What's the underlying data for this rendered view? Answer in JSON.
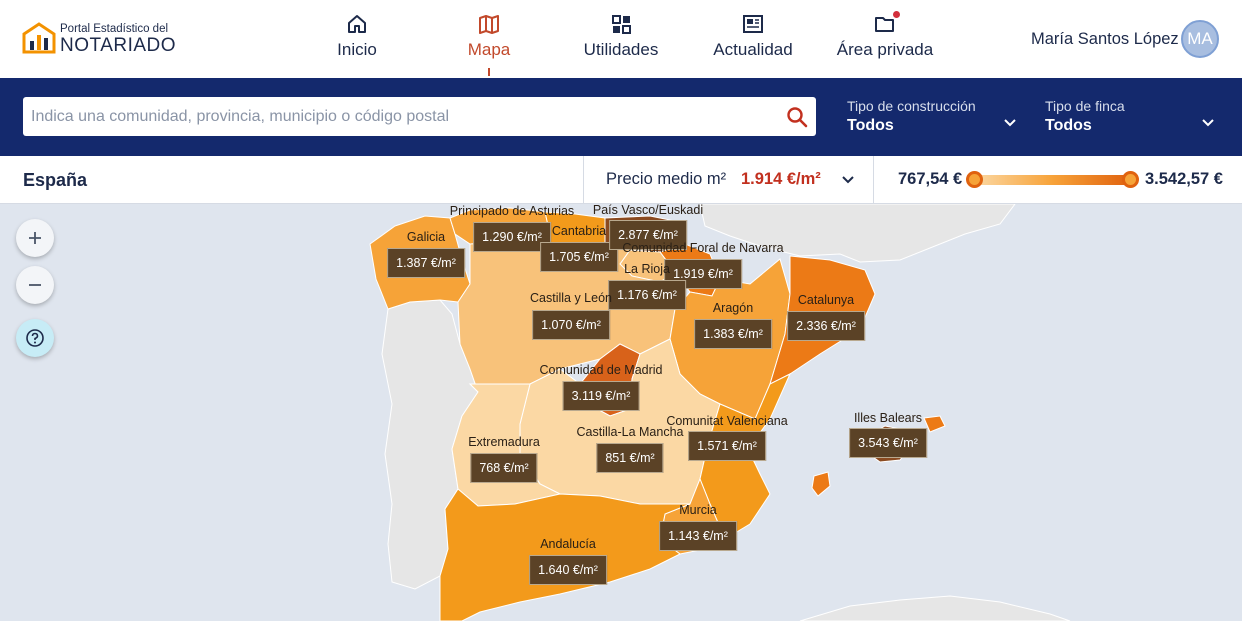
{
  "brand": {
    "line1": "Portal Estadístico del",
    "line2": "NOTARIADO",
    "colors": {
      "orange": "#f39200",
      "navy": "#14296d"
    }
  },
  "nav": {
    "items": [
      {
        "label": "Inicio",
        "icon": "home-icon",
        "active": false
      },
      {
        "label": "Mapa",
        "icon": "map-icon",
        "active": true
      },
      {
        "label": "Utilidades",
        "icon": "grid-icon",
        "active": false
      },
      {
        "label": "Actualidad",
        "icon": "newspaper-icon",
        "active": false
      },
      {
        "label": "Área privada",
        "icon": "folder-icon",
        "active": false,
        "notification": true
      }
    ]
  },
  "user": {
    "name": "María Santos López",
    "initials": "MA"
  },
  "filters": {
    "search_placeholder": "Indica una comunidad, provincia, municipio o código postal",
    "construction": {
      "label": "Tipo de construcción",
      "value": "Todos"
    },
    "estate": {
      "label": "Tipo de finca",
      "value": "Todos"
    }
  },
  "info": {
    "region": "España",
    "price_label": "Precio medio m²",
    "price_value": "1.914 €/m²",
    "range_min": "767,54 €",
    "range_max": "3.542,57 €",
    "range_low": 0,
    "range_high": 1
  },
  "map": {
    "colors": {
      "sea": "#dfe5ee",
      "land_other": "#e6e6e6",
      "level1": "#fbd8a4",
      "level2": "#f8c27a",
      "level3": "#f6a338",
      "level4": "#f39a1b",
      "level5": "#ec7a16",
      "level6": "#d8621a",
      "level7": "#8a4a20"
    },
    "regions": [
      {
        "id": "galicia",
        "name": "Galicia",
        "price": "1.387 €/m²"
      },
      {
        "id": "asturias",
        "name": "Principado de Asturias",
        "price": "1.290 €/m²"
      },
      {
        "id": "cantabria",
        "name": "Cantabria",
        "price": "1.705 €/m²"
      },
      {
        "id": "pais-vasco",
        "name": "País Vasco/Euskadi",
        "price": "2.877 €/m²"
      },
      {
        "id": "navarra",
        "name": "Comunidad Foral de Navarra",
        "price": "1.919 €/m²"
      },
      {
        "id": "la-rioja",
        "name": "La Rioja",
        "price": "1.176 €/m²"
      },
      {
        "id": "castilla-leon",
        "name": "Castilla y León",
        "price": "1.070 €/m²"
      },
      {
        "id": "aragon",
        "name": "Aragón",
        "price": "1.383 €/m²"
      },
      {
        "id": "catalunya",
        "name": "Catalunya",
        "price": "2.336 €/m²"
      },
      {
        "id": "madrid",
        "name": "Comunidad de Madrid",
        "price": "3.119 €/m²"
      },
      {
        "id": "castilla-la-mancha",
        "name": "Castilla-La Mancha",
        "price": "851 €/m²"
      },
      {
        "id": "valenciana",
        "name": "Comunitat Valenciana",
        "price": "1.571 €/m²"
      },
      {
        "id": "baleares",
        "name": "Illes Balears",
        "price": "3.543 €/m²"
      },
      {
        "id": "extremadura",
        "name": "Extremadura",
        "price": "768 €/m²"
      },
      {
        "id": "murcia",
        "name": "Murcia",
        "price": "1.143 €/m²"
      },
      {
        "id": "andalucia",
        "name": "Andalucía",
        "price": "1.640 €/m²"
      }
    ]
  }
}
